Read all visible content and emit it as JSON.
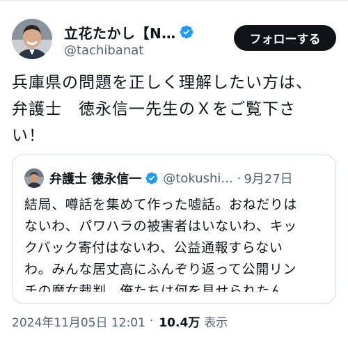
{
  "author": {
    "display_name": "立花たかし【N…",
    "handle": "@tachibanat",
    "follow_label": "フォローする"
  },
  "tweet": {
    "text": "兵庫県の問題を正しく理解したい方は、\n弁護士　徳永信一先生のＸをご覧下さ\nい！"
  },
  "quote": {
    "display_name": "弁護士 徳永信一",
    "handle": "@tokushi...",
    "separator": "·",
    "date": "9月27日",
    "text": "結局、噂話を集めて作った嘘話。おねだりは\nないわ、パワハラの被害者はいないわ、キッ\nクバック寄付はないわ、公益通報すらない\nわ。みんな居丈高にふんぞり返って公開リン\nチの魔女裁判。俺たちは何を見せられたん..."
  },
  "meta": {
    "timestamp": "2024年11月05日 12:01",
    "separator": "·",
    "views_count": "10.4万",
    "views_label": "表示"
  },
  "colors": {
    "verified_blue": "#1d9bf0",
    "secondary_text": "#536471",
    "primary_text": "#0f1419",
    "border": "#cfd9de"
  },
  "icons": {
    "verified": "verified-badge-icon"
  }
}
